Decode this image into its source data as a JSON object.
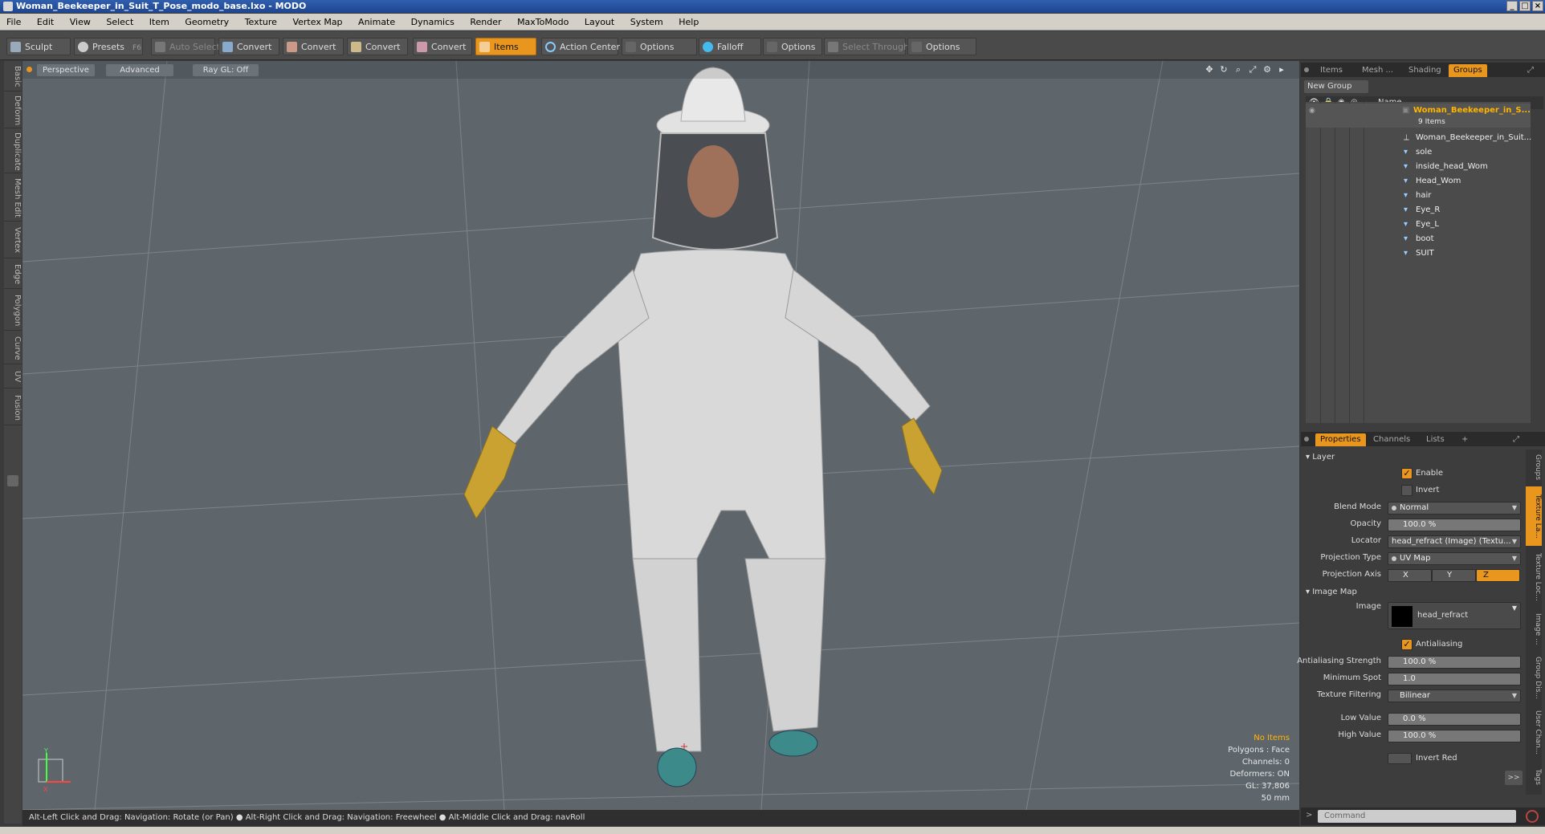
{
  "window": {
    "title": "Woman_Beekeeper_in_Suit_T_Pose_modo_base.lxo - MODO"
  },
  "menubar": [
    "File",
    "Edit",
    "View",
    "Select",
    "Item",
    "Geometry",
    "Texture",
    "Vertex Map",
    "Animate",
    "Dynamics",
    "Render",
    "MaxToModo",
    "Layout",
    "System",
    "Help"
  ],
  "toolbar": {
    "sculpt": "Sculpt",
    "presets": "Presets",
    "presets_hotkey": "F6",
    "auto_select": "Auto Select",
    "convert": "Convert",
    "items": "Items",
    "action_center": "Action Center",
    "options": "Options",
    "falloff": "Falloff",
    "select_through": "Select Through"
  },
  "left_tabs": [
    "Basic",
    "Deform",
    "Duplicate",
    "Mesh Edit",
    "Vertex",
    "Edge",
    "Polygon",
    "Curve",
    "UV",
    "Fusion"
  ],
  "viewport": {
    "view": "Perspective",
    "shading": "Advanced",
    "raygl": "Ray GL: Off",
    "hud": {
      "selection": "No Items",
      "polygons": "Polygons : Face",
      "channels": "Channels: 0",
      "deformers": "Deformers: ON",
      "gl": "GL: 37,806",
      "scale": "50 mm"
    },
    "axis_y": "Y",
    "axis_x": "X"
  },
  "status": "Alt-Left Click and Drag: Navigation: Rotate (or Pan) ● Alt-Right Click and Drag: Navigation: Freewheel ● Alt-Middle Click and Drag: navRoll",
  "top_panel": {
    "tabs": [
      "Items",
      "Mesh ...",
      "Shading",
      "Groups"
    ],
    "active_tab": "Groups",
    "new_group": "New Group",
    "column_name": "Name",
    "group_name": "Woman_Beekeeper_in_S...",
    "group_count": "9 Items",
    "items": [
      "Woman_Beekeeper_in_Suit...",
      "sole",
      "inside_head_Wom",
      "Head_Wom",
      "hair",
      "Eye_R",
      "Eye_L",
      "boot",
      "SUIT"
    ]
  },
  "bottom_panel": {
    "tabs": [
      "Properties",
      "Channels",
      "Lists",
      "+"
    ],
    "layer_section": "Layer",
    "enable": "Enable",
    "invert": "Invert",
    "blend_mode_label": "Blend Mode",
    "blend_mode": "Normal",
    "opacity_label": "Opacity",
    "opacity": "100.0 %",
    "locator_label": "Locator",
    "locator": "head_refract (Image) (Textu...",
    "projection_type_label": "Projection Type",
    "projection_type": "UV Map",
    "projection_axis_label": "Projection Axis",
    "axis_x": "X",
    "axis_y": "Y",
    "axis_z": "Z",
    "image_map_section": "Image Map",
    "image_label": "Image",
    "image": "head_refract",
    "antialiasing": "Antialiasing",
    "aa_strength_label": "Antialiasing Strength",
    "aa_strength": "100.0 %",
    "min_spot_label": "Minimum Spot",
    "min_spot": "1.0",
    "tex_filter_label": "Texture Filtering",
    "tex_filter": "Bilinear",
    "low_value_label": "Low Value",
    "low_value": "0.0 %",
    "high_value_label": "High Value",
    "high_value": "100.0 %",
    "invert_red": "Invert Red",
    "expand": ">>"
  },
  "right_tabs": [
    "Groups",
    "Texture La...",
    "Texture Loc...",
    "Image ...",
    "Group Dis...",
    "User Chan...",
    "Tags"
  ],
  "command": {
    "placeholder": "Command"
  },
  "colors": {
    "accent": "#e8961e",
    "viewport_bg": "#5e666c",
    "suit": "#d9d9d9",
    "glove": "#c9a232"
  }
}
